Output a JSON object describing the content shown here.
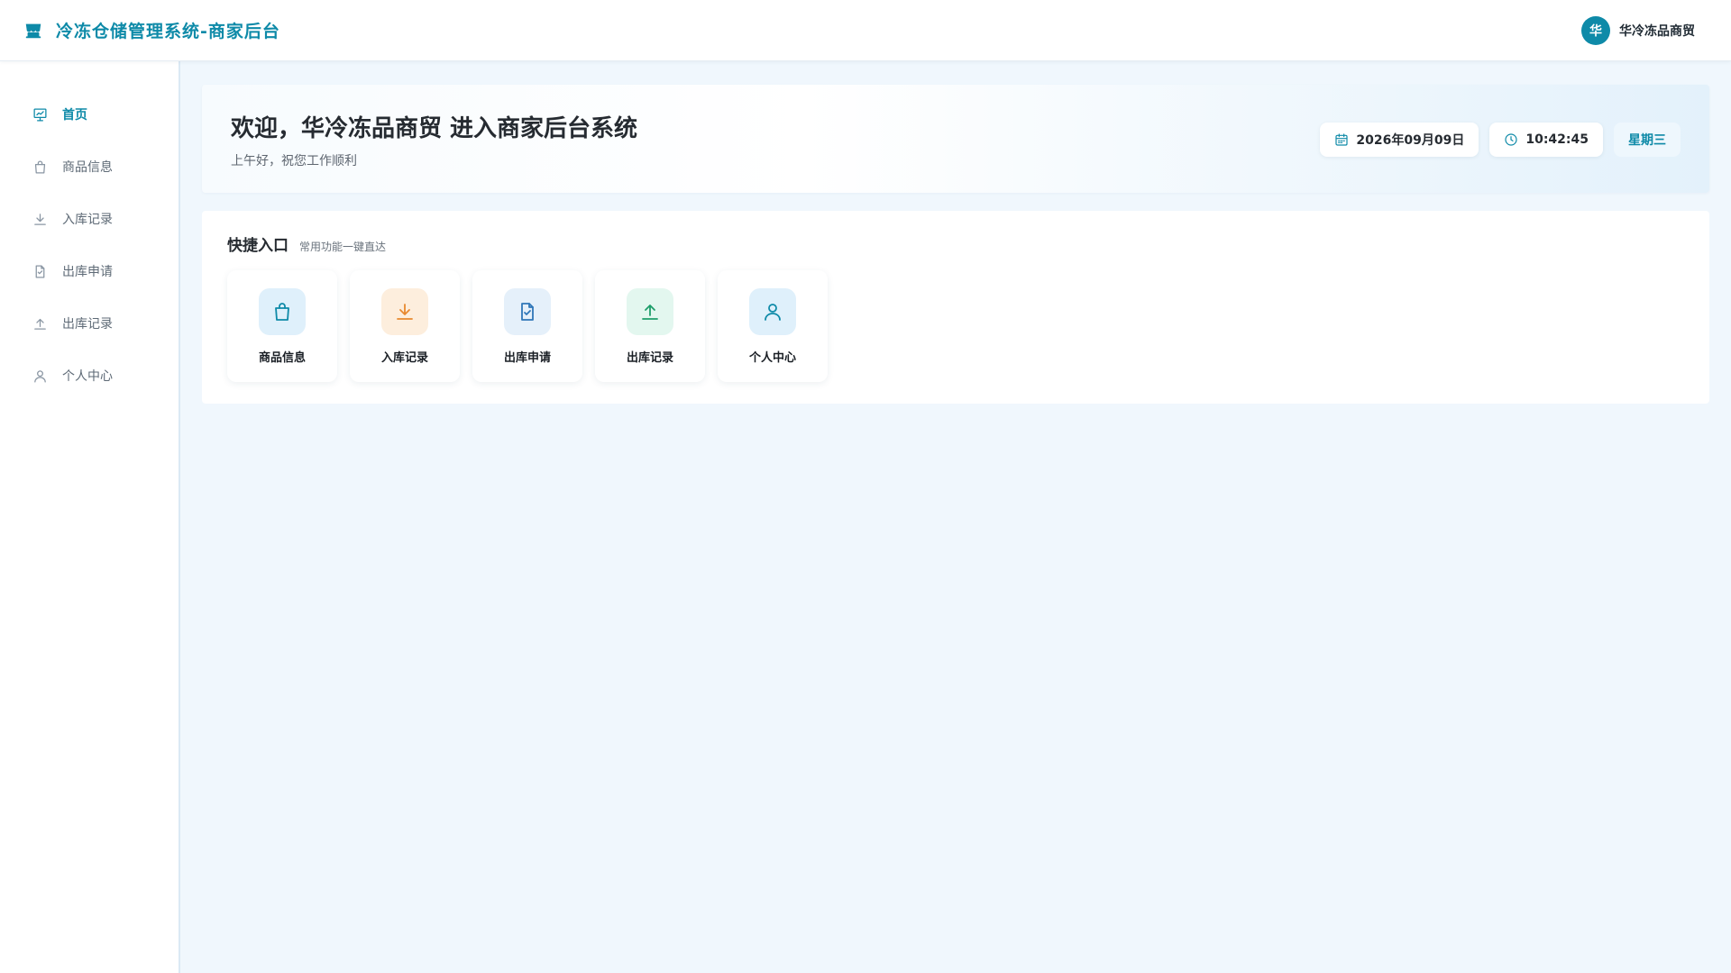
{
  "header": {
    "title": "冷冻仓储管理系统-商家后台",
    "brand_icon": "store-icon",
    "user": {
      "avatar_text": "华",
      "name": "华冷冻品商贸"
    }
  },
  "sidebar": {
    "items": [
      {
        "label": "首页",
        "icon": "chart-board-icon",
        "active": true
      },
      {
        "label": "商品信息",
        "icon": "shopping-bag-icon",
        "active": false
      },
      {
        "label": "入库记录",
        "icon": "download-icon",
        "active": false
      },
      {
        "label": "出库申请",
        "icon": "file-check-icon",
        "active": false
      },
      {
        "label": "出库记录",
        "icon": "upload-icon",
        "active": false
      },
      {
        "label": "个人中心",
        "icon": "user-icon",
        "active": false
      }
    ]
  },
  "welcome": {
    "title": "欢迎，华冷冻品商贸 进入商家后台系统",
    "subtitle": "上午好，祝您工作顺利",
    "date": "2026年09月09日",
    "time": "10:42:45",
    "weekday": "星期三"
  },
  "quick": {
    "title": "快捷入口",
    "subtitle": "常用功能一键直达",
    "items": [
      {
        "label": "商品信息",
        "icon": "shopping-bag-icon",
        "bg": "#dff0fb",
        "color": "#0e8aa8"
      },
      {
        "label": "入库记录",
        "icon": "download-icon",
        "bg": "#fdeedd",
        "color": "#e8892f"
      },
      {
        "label": "出库申请",
        "icon": "file-check-icon",
        "bg": "#e5f0fa",
        "color": "#2f77b8"
      },
      {
        "label": "出库记录",
        "icon": "upload-icon",
        "bg": "#e3f7ef",
        "color": "#1e9e6a"
      },
      {
        "label": "个人中心",
        "icon": "user-icon",
        "bg": "#dff0fb",
        "color": "#0e8aa8"
      }
    ]
  },
  "colors": {
    "accent": "#0e8aa8",
    "page_bg": "#f0f7fd"
  }
}
